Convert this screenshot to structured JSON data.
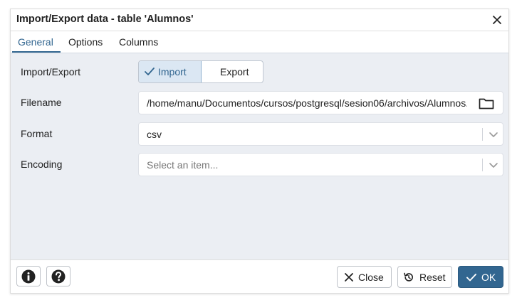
{
  "dialog": {
    "title": "Import/Export data - table 'Alumnos'",
    "close_icon": "close-icon"
  },
  "tabs": [
    {
      "label": "General",
      "active": true
    },
    {
      "label": "Options",
      "active": false
    },
    {
      "label": "Columns",
      "active": false
    }
  ],
  "form": {
    "import_export": {
      "label": "Import/Export",
      "options": [
        "Import",
        "Export"
      ],
      "selected": "Import"
    },
    "filename": {
      "label": "Filename",
      "value": "/home/manu/Documentos/cursos/postgresql/sesion06/archivos/Alumnos.csv",
      "browse_icon": "folder-icon"
    },
    "format": {
      "label": "Format",
      "value": "csv"
    },
    "encoding": {
      "label": "Encoding",
      "placeholder": "Select an item..."
    }
  },
  "footer": {
    "info_icon": "info-icon",
    "help_icon": "help-icon",
    "close_label": "Close",
    "reset_label": "Reset",
    "ok_label": "OK"
  },
  "colors": {
    "accent": "#326690",
    "body_background": "#ebeef3",
    "toggle_selected": "#dbe7f3"
  }
}
